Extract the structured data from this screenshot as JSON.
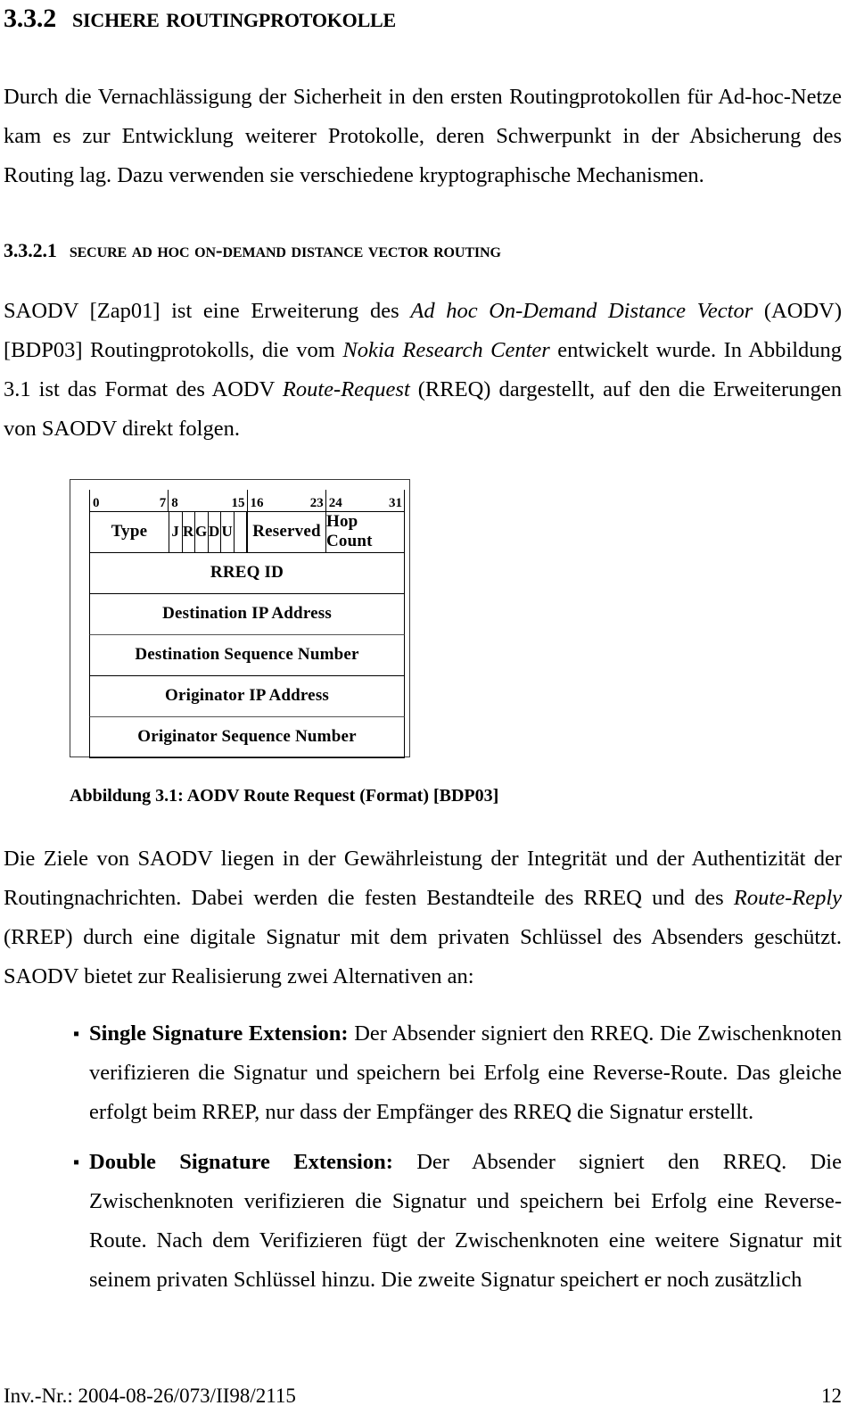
{
  "section": {
    "number": "3.3.2",
    "title": "Sichere Routingprotokolle"
  },
  "intro_paragraph": {
    "text": "Durch die Vernachlässigung der Sicherheit in den ersten Routingprotokollen für Ad-hoc-Netze kam es zur Entwicklung weiterer Protokolle, deren Schwerpunkt in der Absicherung des Routing lag. Dazu verwenden sie verschiedene kryptographische Mechanismen."
  },
  "subsection": {
    "number": "3.3.2.1",
    "title": "Secure Ad hoc On-Demand Distance Vector Routing"
  },
  "paragraph_saodv": {
    "part1": "SAODV [Zap01] ist eine Erweiterung des ",
    "italic1": "Ad hoc On-Demand Distance Vector",
    "part2": " (AODV) [BDP03] Routingprotokolls, die vom ",
    "italic2": "Nokia Research Center",
    "part3": " entwickelt wurde. In Abbildung 3.1 ist das Format des AODV ",
    "italic3": "Route-Request",
    "part4": " (RREQ) dargestellt, auf den die Erweiterungen von SAODV direkt folgen."
  },
  "figure": {
    "caption": "Abbildung 3.1: AODV Route Request (Format) [BDP03]",
    "bit_ruler": [
      {
        "start": "0",
        "end": "7"
      },
      {
        "start": "8",
        "end": "15"
      },
      {
        "start": "16",
        "end": "23"
      },
      {
        "start": "24",
        "end": "31"
      }
    ],
    "header_row": {
      "type": "Type",
      "flags": [
        "J",
        "R",
        "G",
        "D",
        "U",
        "",
        "",
        ""
      ],
      "reserved": "Reserved",
      "hop_count": "Hop Count"
    },
    "rows": [
      "RREQ ID",
      "Destination IP Address",
      "Destination Sequence Number",
      "Originator IP Address",
      "Originator Sequence Number"
    ]
  },
  "paragraph_ziele": {
    "part1": "Die Ziele von SAODV liegen in der Gewährleistung der Integrität und der Authentizität der Routingnachrichten. Dabei werden die festen Bestandteile des RREQ und des ",
    "italic1": "Route-Reply",
    "part2": " (RREP) durch eine digitale Signatur mit dem privaten Schlüssel des Absenders geschützt. SAODV bietet zur Realisierung zwei Alternativen an:"
  },
  "bullets": [
    {
      "marker": "▪",
      "label": "Single Signature Extension:",
      "text": " Der Absender signiert den RREQ. Die Zwischenknoten verifizieren die Signatur und speichern bei Erfolg eine Reverse-Route. Das gleiche erfolgt beim RREP, nur dass der Empfänger des RREQ die Signatur erstellt."
    },
    {
      "marker": "▪",
      "label": "Double Signature Extension:",
      "text": " Der Absender signiert den RREQ. Die Zwischenknoten verifizieren die Signatur und speichern bei Erfolg eine Reverse-Route. Nach dem Verifizieren fügt der Zwischenknoten eine weitere Signatur mit seinem privaten Schlüssel hinzu. Die zweite Signatur speichert er noch zusätzlich"
    }
  ],
  "footer": {
    "inventory": "Inv.-Nr.: 2004-08-26/073/II98/2115",
    "page_number": "12"
  }
}
